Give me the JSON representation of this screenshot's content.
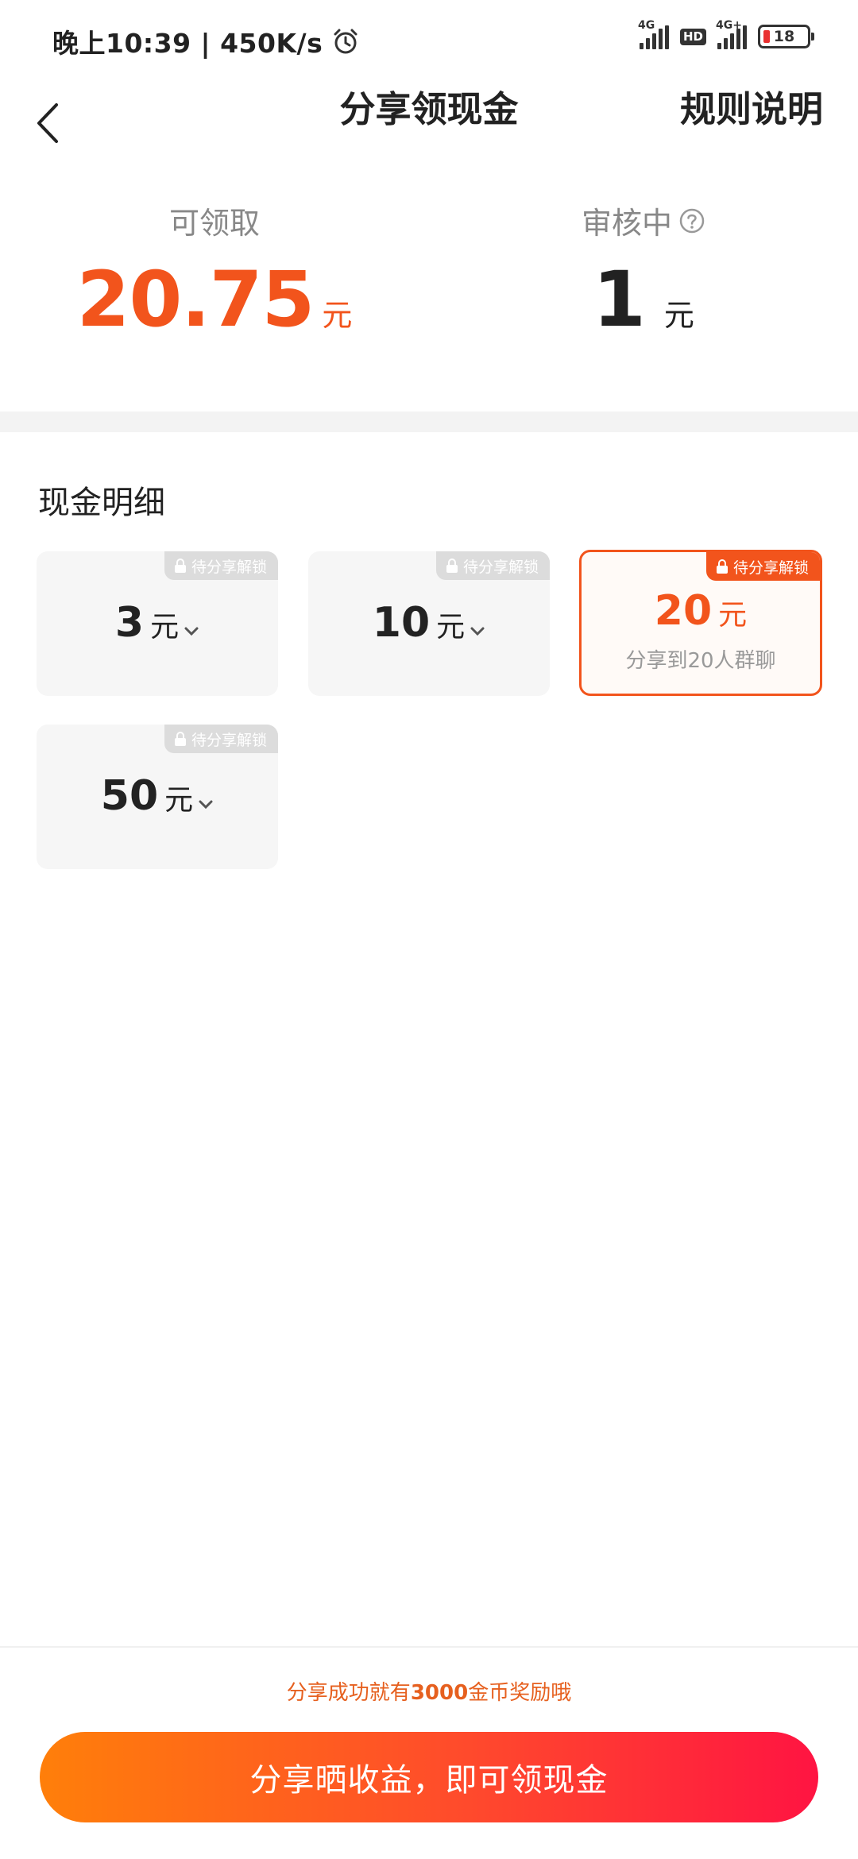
{
  "status_bar": {
    "time": "晚上10:39 | 450K/s",
    "network_tag_1": "4G",
    "hd_label": "HD",
    "network_tag_2": "4G+",
    "battery": "18"
  },
  "nav": {
    "title": "分享领现金",
    "rules_label": "规则说明"
  },
  "summary": {
    "available_label": "可领取",
    "available_amount": "20.75",
    "available_unit": "元",
    "reviewing_label": "审核中",
    "reviewing_amount": "1",
    "reviewing_unit": "元"
  },
  "details": {
    "title": "现金明细",
    "cards": [
      {
        "badge": "待分享解锁",
        "value": "3",
        "unit": "元"
      },
      {
        "badge": "待分享解锁",
        "value": "10",
        "unit": "元"
      },
      {
        "badge": "待分享解锁",
        "value": "20",
        "unit": "元",
        "subtitle": "分享到20人群聊"
      },
      {
        "badge": "待分享解锁",
        "value": "50",
        "unit": "元"
      }
    ]
  },
  "bottom": {
    "hint_prefix": "分享成功就有",
    "hint_highlight": "3000",
    "hint_suffix": "金币奖励哦",
    "button_label": "分享晒收益，即可领现金"
  },
  "colors": {
    "accent": "#f2541c",
    "button_gradient_start": "#ff7f0a",
    "button_gradient_end": "#ff1442"
  }
}
